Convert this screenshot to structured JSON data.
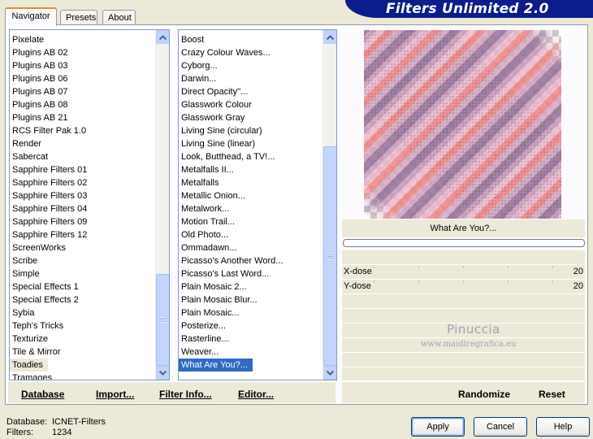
{
  "banner": {
    "title": "Filters Unlimited 2.0"
  },
  "tabs": [
    {
      "label": "Navigator",
      "active": true
    },
    {
      "label": "Presets",
      "active": false
    },
    {
      "label": "About",
      "active": false
    }
  ],
  "categories": {
    "items": [
      "Pixelate",
      "Plugins AB 02",
      "Plugins AB 03",
      "Plugins AB 06",
      "Plugins AB 07",
      "Plugins AB 08",
      "Plugins AB 21",
      "RCS Filter Pak 1.0",
      "Render",
      "Sabercat",
      "Sapphire Filters 01",
      "Sapphire Filters 02",
      "Sapphire Filters 03",
      "Sapphire Filters 04",
      "Sapphire Filters 09",
      "Sapphire Filters 12",
      "ScreenWorks",
      "Scribe",
      "Simple",
      "Special Effects 1",
      "Special Effects 2",
      "Sybia",
      "Teph's Tricks",
      "Texturize",
      "Tile & Mirror",
      "Toadies",
      "Tramages"
    ],
    "selected": "Toadies"
  },
  "filters": {
    "items": [
      "Boost",
      "Crazy Colour Waves...",
      "Cyborg...",
      "Darwin...",
      "Direct Opacity''...",
      "Glasswork Colour",
      "Glasswork Gray",
      "Living Sine (circular)",
      "Living Sine (linear)",
      "Look, Butthead, a TV!...",
      "Metalfalls II...",
      "Metalfalls",
      "Metallic Onion...",
      "Metalwork...",
      "Motion Trail...",
      "Old Photo...",
      "Ommadawn...",
      "Picasso's Another Word...",
      "Picasso's Last Word...",
      "Plain Mosaic 2...",
      "Plain Mosaic Blur...",
      "Plain Mosaic...",
      "Posterize...",
      "Rasterline...",
      "Weaver...",
      "What Are You?..."
    ],
    "selected": "What Are You?..."
  },
  "preview": {
    "filter_name": "What Are You?..."
  },
  "params": [
    {
      "label": "X-dose",
      "value": "20"
    },
    {
      "label": "Y-dose",
      "value": "20"
    }
  ],
  "watermark": {
    "line1": "Pinuccia",
    "line2": "www.maidiregrafica.eu"
  },
  "actions": {
    "database": "Database",
    "import": "Import...",
    "filter_info": "Filter Info...",
    "editor": "Editor...",
    "randomize": "Randomize",
    "reset": "Reset"
  },
  "footer": {
    "database_label": "Database:",
    "database_value": "ICNET-Filters",
    "filters_label": "Filters:",
    "filters_value": "1234"
  },
  "buttons": {
    "apply": "Apply",
    "cancel": "Cancel",
    "help": "Help"
  }
}
